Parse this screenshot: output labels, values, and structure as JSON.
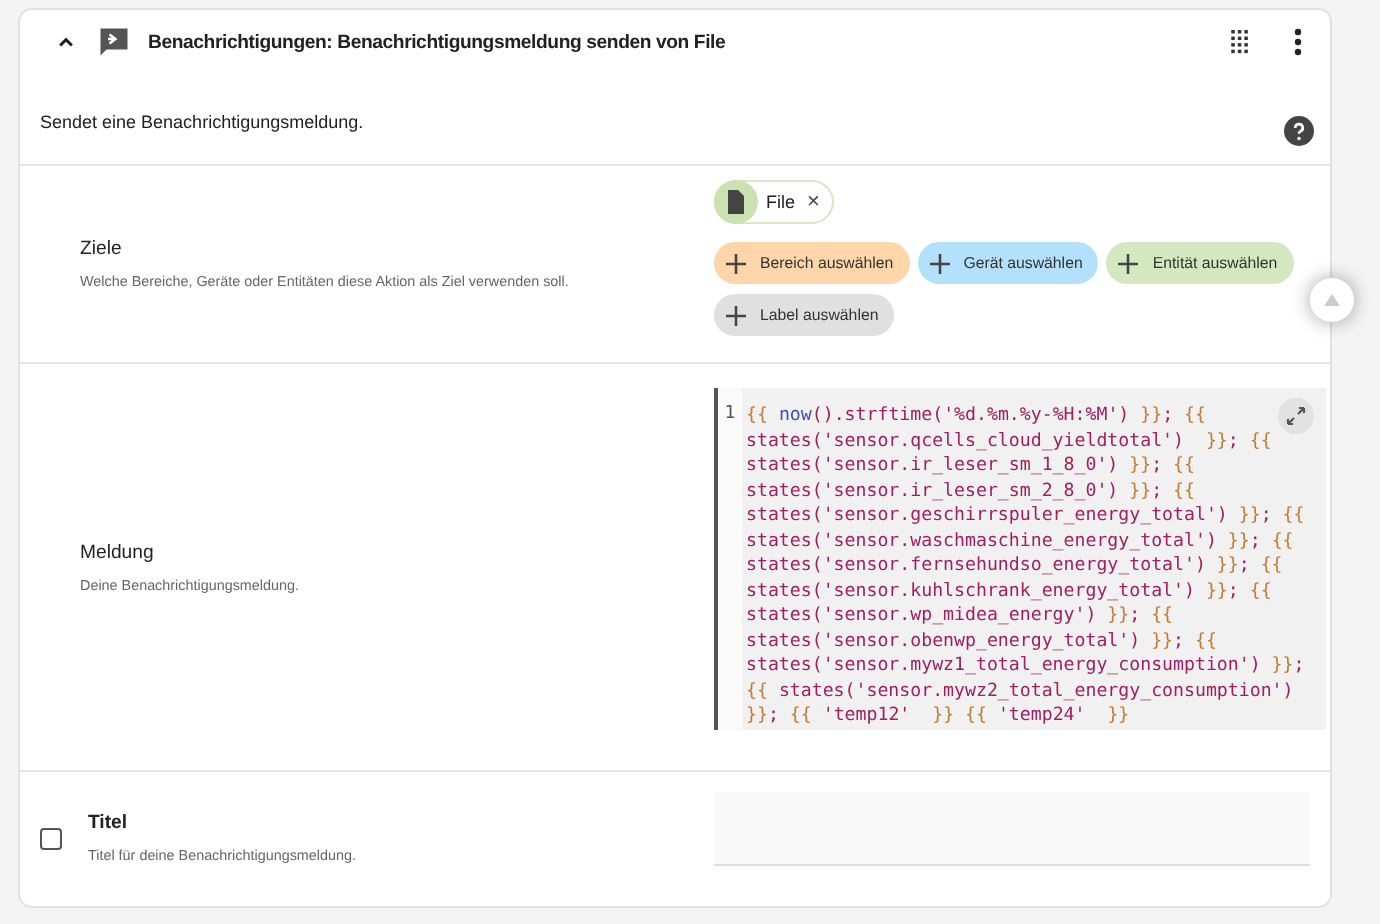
{
  "header": {
    "title": "Benachrichtigungen: Benachrichtigungsmeldung senden von File",
    "expanded": true
  },
  "description": "Sendet eine Benachrichtigungsmeldung.",
  "sections": [
    {
      "kind": "targets",
      "label": "Ziele",
      "hint": "Welche Bereiche, Geräte oder Entitäten diese Aktion als Ziel verwenden soll.",
      "chips": [
        {
          "label": "File",
          "remove": "×"
        }
      ],
      "buttons": [
        {
          "label": "Bereich auswählen",
          "color": "#fed6a9"
        },
        {
          "label": "Gerät auswählen",
          "color": "#b3e1fb"
        },
        {
          "label": "Entität auswählen",
          "color": "#d3e8bf"
        },
        {
          "label": "Label auswählen",
          "color": "#e0e0e0"
        }
      ]
    },
    {
      "kind": "code",
      "label": "Meldung",
      "hint": "Deine Benachrichtigungsmeldung.",
      "line_number": "1",
      "lines": [
        [
          {
            "kind": "delim",
            "text": "{{ "
          },
          {
            "kind": "name",
            "text": "now"
          },
          {
            "kind": "text",
            "text": "().strftime('%d.%m.%y-%H:%M') "
          },
          {
            "kind": "delim",
            "text": "}}"
          },
          {
            "kind": "text",
            "text": "; "
          },
          {
            "kind": "delim",
            "text": "{{"
          }
        ],
        [
          {
            "kind": "text",
            "text": "states('sensor.qcells_cloud_yieldtotal')  "
          },
          {
            "kind": "delim",
            "text": "}}"
          },
          {
            "kind": "text",
            "text": "; "
          },
          {
            "kind": "delim",
            "text": "{{"
          }
        ],
        [
          {
            "kind": "text",
            "text": "states('sensor.ir_leser_sm_1_8_0') "
          },
          {
            "kind": "delim",
            "text": "}}"
          },
          {
            "kind": "text",
            "text": "; "
          },
          {
            "kind": "delim",
            "text": "{{"
          }
        ],
        [
          {
            "kind": "text",
            "text": "states('sensor.ir_leser_sm_2_8_0') "
          },
          {
            "kind": "delim",
            "text": "}}"
          },
          {
            "kind": "text",
            "text": "; "
          },
          {
            "kind": "delim",
            "text": "{{"
          }
        ],
        [
          {
            "kind": "text",
            "text": "states('sensor.geschirrspuler_energy_total') "
          },
          {
            "kind": "delim",
            "text": "}}"
          },
          {
            "kind": "text",
            "text": "; "
          },
          {
            "kind": "delim",
            "text": "{{"
          }
        ],
        [
          {
            "kind": "text",
            "text": "states('sensor.waschmaschine_energy_total') "
          },
          {
            "kind": "delim",
            "text": "}}"
          },
          {
            "kind": "text",
            "text": "; "
          },
          {
            "kind": "delim",
            "text": "{{"
          }
        ],
        [
          {
            "kind": "text",
            "text": "states('sensor.fernsehundso_energy_total') "
          },
          {
            "kind": "delim",
            "text": "}}"
          },
          {
            "kind": "text",
            "text": "; "
          },
          {
            "kind": "delim",
            "text": "{{"
          }
        ],
        [
          {
            "kind": "text",
            "text": "states('sensor.kuhlschrank_energy_total') "
          },
          {
            "kind": "delim",
            "text": "}}"
          },
          {
            "kind": "text",
            "text": "; "
          },
          {
            "kind": "delim",
            "text": "{{"
          }
        ],
        [
          {
            "kind": "text",
            "text": "states('sensor.wp_midea_energy') "
          },
          {
            "kind": "delim",
            "text": "}}"
          },
          {
            "kind": "text",
            "text": "; "
          },
          {
            "kind": "delim",
            "text": "{{"
          }
        ],
        [
          {
            "kind": "text",
            "text": "states('sensor.obenwp_energy_total') "
          },
          {
            "kind": "delim",
            "text": "}}"
          },
          {
            "kind": "text",
            "text": "; "
          },
          {
            "kind": "delim",
            "text": "{{"
          }
        ],
        [
          {
            "kind": "text",
            "text": "states('sensor.mywz1_total_energy_consumption') "
          },
          {
            "kind": "delim",
            "text": "}}"
          },
          {
            "kind": "text",
            "text": ";"
          }
        ],
        [
          {
            "kind": "delim",
            "text": "{{ "
          },
          {
            "kind": "text",
            "text": "states('sensor.mywz2_total_energy_consumption')"
          }
        ],
        [
          {
            "kind": "delim",
            "text": "}}"
          },
          {
            "kind": "text",
            "text": "; "
          },
          {
            "kind": "delim",
            "text": "{{ "
          },
          {
            "kind": "text",
            "text": "'temp12'  "
          },
          {
            "kind": "delim",
            "text": "}} {{ "
          },
          {
            "kind": "text",
            "text": "'temp24'  "
          },
          {
            "kind": "delim",
            "text": "}}"
          }
        ]
      ]
    },
    {
      "kind": "field",
      "label": "Titel",
      "hint": "Titel für deine Benachrichtigungsmeldung.",
      "checked": false
    }
  ]
}
